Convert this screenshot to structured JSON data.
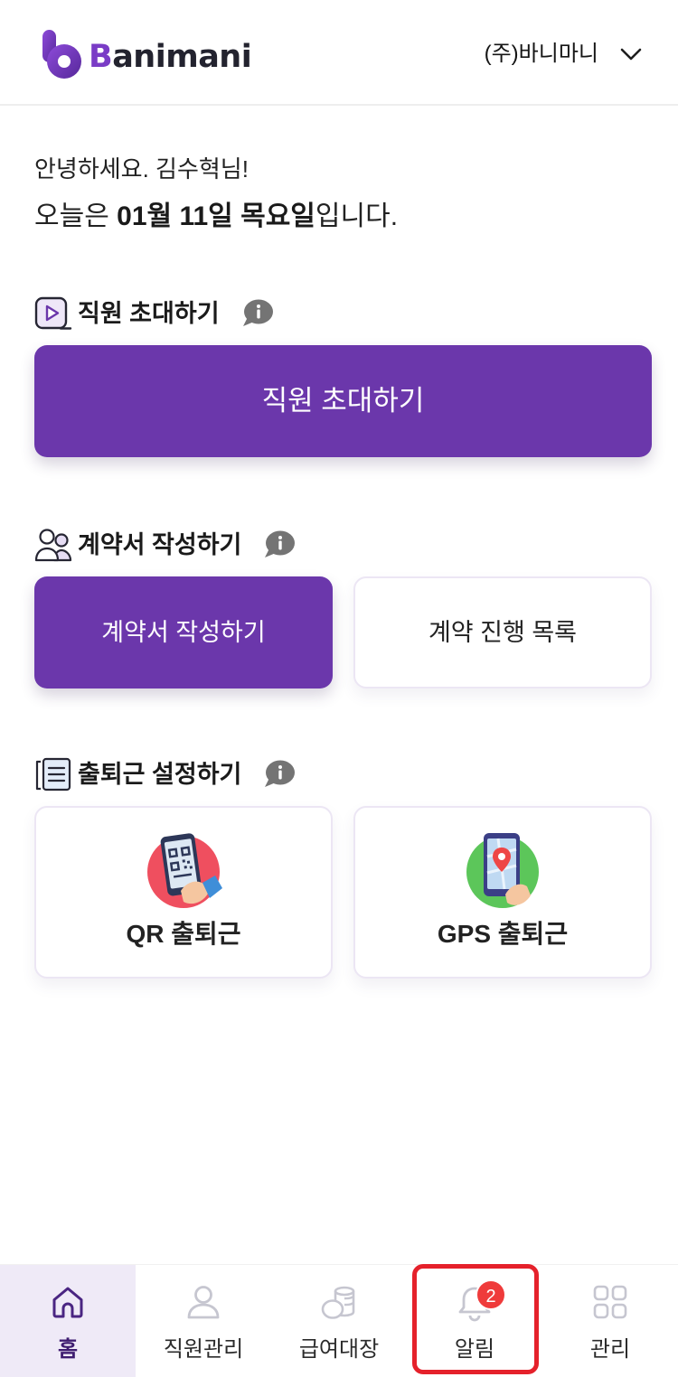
{
  "header": {
    "logo_text": "Banimani",
    "company_name": "(주)바니마니",
    "dropdown_icon": "chevron-down-icon"
  },
  "greeting": {
    "line1": "안녕하세요. 김수혁님!",
    "line2_prefix": "오늘은 ",
    "line2_date": "01월 11일 목요일",
    "line2_suffix": "입니다."
  },
  "sections": {
    "invite": {
      "icon": "invite-icon",
      "title": "직원 초대하기",
      "button_label": "직원 초대하기"
    },
    "contract": {
      "icon": "people-icon",
      "title": "계약서 작성하기",
      "primary_label": "계약서 작성하기",
      "secondary_label": "계약 진행 목록"
    },
    "attendance": {
      "icon": "document-list-icon",
      "title": "출퇴근 설정하기",
      "qr_label": "QR 출퇴근",
      "gps_label": "GPS 출퇴근"
    }
  },
  "bottom_nav": {
    "items": [
      {
        "label": "홈",
        "icon": "home-icon",
        "active": true
      },
      {
        "label": "직원관리",
        "icon": "person-icon",
        "active": false
      },
      {
        "label": "급여대장",
        "icon": "coins-icon",
        "active": false
      },
      {
        "label": "알림",
        "icon": "bell-icon",
        "active": false,
        "badge": "2"
      },
      {
        "label": "관리",
        "icon": "grid-icon",
        "active": false
      }
    ]
  },
  "colors": {
    "primary": "#6B37AB",
    "active_nav_bg": "#EFEAF7",
    "highlight_border": "#E5212B",
    "badge": "#EF3B3B",
    "qr_circle": "#EF4F5F",
    "gps_circle": "#5CC65A"
  }
}
